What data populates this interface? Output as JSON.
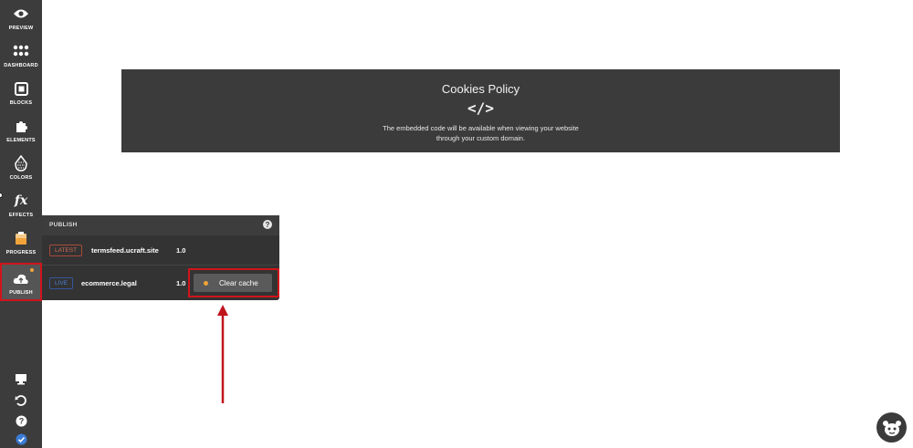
{
  "sidebar": {
    "items": [
      {
        "label": "PREVIEW",
        "icon": "eye-icon"
      },
      {
        "label": "DASHBOARD",
        "icon": "grid-icon"
      },
      {
        "label": "BLOCKS",
        "icon": "blocks-icon"
      },
      {
        "label": "ELEMENTS",
        "icon": "puzzle-icon"
      },
      {
        "label": "COLORS",
        "icon": "palette-icon"
      },
      {
        "label": "EFFECTS",
        "icon": "fx-icon"
      },
      {
        "label": "PROGRESS",
        "icon": "progress-icon"
      },
      {
        "label": "PUBLISH",
        "icon": "cloud-upload-icon"
      }
    ],
    "bottom_icons": [
      "desktop-icon",
      "undo-icon",
      "help-icon",
      "check-badge-icon"
    ]
  },
  "embed": {
    "title": "Cookies Policy",
    "code_symbol": "</>",
    "line1": "The embedded code will be available when viewing your website",
    "line2": "through your custom domain."
  },
  "publish_panel": {
    "title": "PUBLISH",
    "help_glyph": "?",
    "rows": [
      {
        "tag": "LATEST",
        "domain": "termsfeed.ucraft.site",
        "version": "1.0"
      },
      {
        "tag": "LIVE",
        "domain": "ecommerce.legal",
        "version": "1.0",
        "button": "Clear cache"
      }
    ]
  },
  "colors": {
    "sidebar_bg": "#3c3c3c",
    "highlight": "#d0141b",
    "latest_tag": "#d66a52",
    "live_tag": "#4b82d6",
    "status_dot": "#f2a33a"
  }
}
